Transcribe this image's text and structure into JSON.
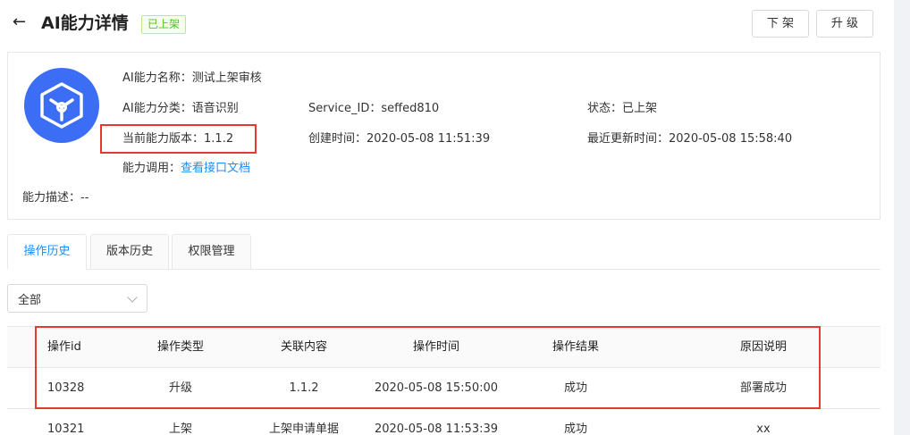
{
  "header": {
    "title": "AI能力详情",
    "status_badge": "已上架",
    "btn_off_shelf": "下 架",
    "btn_upgrade": "升 级"
  },
  "info": {
    "name_label": "AI能力名称：",
    "name_value": "测试上架审核",
    "category_label": "AI能力分类：",
    "category_value": "语音识别",
    "service_id_label": "Service_ID：",
    "service_id_value": "seffed810",
    "status_label": "状态：",
    "status_value": "已上架",
    "version_label": "当前能力版本：",
    "version_value": "1.1.2",
    "created_label": "创建时间：",
    "created_value": "2020-05-08 11:51:39",
    "updated_label": "最近更新时间：",
    "updated_value": "2020-05-08 15:58:40",
    "invoke_label": "能力调用：",
    "invoke_link": "查看接口文档",
    "desc_label": "能力描述：",
    "desc_value": "--"
  },
  "tabs": [
    {
      "label": "操作历史",
      "active": true
    },
    {
      "label": "版本历史",
      "active": false
    },
    {
      "label": "权限管理",
      "active": false
    }
  ],
  "filter": {
    "selected": "全部"
  },
  "table": {
    "columns": [
      "操作id",
      "操作类型",
      "关联内容",
      "操作时间",
      "操作结果",
      "原因说明"
    ],
    "rows": [
      {
        "id": "10328",
        "type": "升级",
        "related": "1.1.2",
        "time": "2020-05-08 15:50:00",
        "result": "成功",
        "reason": "部署成功"
      },
      {
        "id": "10321",
        "type": "上架",
        "related": "上架申请单据",
        "time": "2020-05-08 11:53:39",
        "result": "成功",
        "reason": "xx"
      }
    ]
  },
  "colors": {
    "accent": "#1890ff",
    "logo": "#3b6df5",
    "highlight": "#e53935",
    "badge": "#52c41a"
  }
}
